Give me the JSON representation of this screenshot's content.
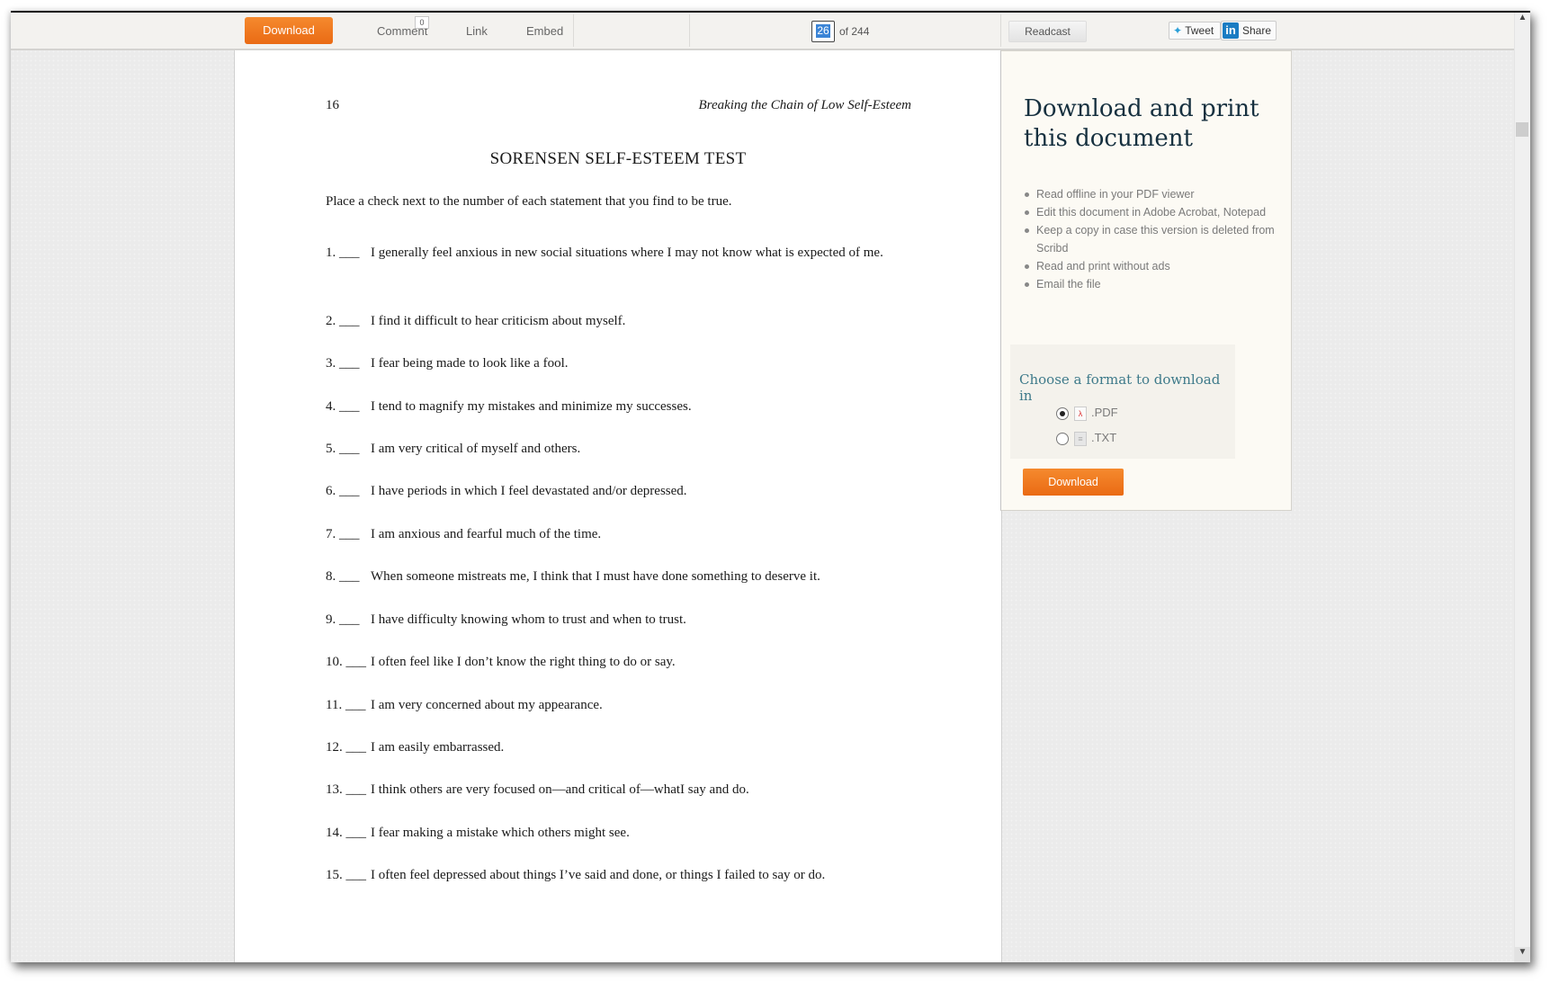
{
  "toolbar": {
    "download_label": "Download",
    "comment_label": "Comment",
    "comment_count": "0",
    "link_label": "Link",
    "embed_label": "Embed",
    "page_current": "26",
    "page_of": "of 244",
    "readcast_label": "Readcast",
    "tweet_label": "Tweet",
    "share_label": "Share",
    "accent_color": "#ef7a21"
  },
  "document": {
    "page_number": "16",
    "running_head": "Breaking the Chain of Low Self-Esteem",
    "title": "SORENSEN SELF-ESTEEM TEST",
    "intro": "Place a check next to the number of each statement that you find to be true.",
    "items": [
      {
        "num": "1. ___",
        "text": "I generally feel anxious in new social situations where I may not know what is expected of me."
      },
      {
        "num": "2. ___",
        "text": "I find it difficult to hear criticism about myself."
      },
      {
        "num": "3. ___",
        "text": "I fear being made to look like a fool."
      },
      {
        "num": "4. ___",
        "text": "I tend to magnify my mistakes and minimize my successes."
      },
      {
        "num": "5. ___",
        "text": "I am very critical of myself and others."
      },
      {
        "num": "6. ___",
        "text": "I have periods in which I feel devastated and/or depressed."
      },
      {
        "num": "7. ___",
        "text": "I am anxious and fearful much of the time."
      },
      {
        "num": "8. ___",
        "text": "When someone mistreats me, I think that I must have done something to deserve it."
      },
      {
        "num": "9. ___",
        "text": "I have difficulty knowing whom to trust and when to trust."
      },
      {
        "num": "10. ___",
        "text": "I often feel like I don’t know the right thing to do or say."
      },
      {
        "num": "11. ___",
        "text": "I am very concerned about my appearance."
      },
      {
        "num": "12. ___",
        "text": "I am easily embarrassed."
      },
      {
        "num": "13. ___",
        "text": "I think others are very focused on—and critical of—whatI say and do."
      },
      {
        "num": "14. ___",
        "text": "I fear making a mistake which others might see."
      },
      {
        "num": "15. ___",
        "text": "I often feel depressed about things I’ve said and done, or things I failed to say or do."
      }
    ]
  },
  "side_panel": {
    "title": "Download and print this document",
    "benefits": [
      "Read offline in your PDF viewer",
      "Edit this document in Adobe Acrobat, Notepad",
      "Keep a copy in case this version is deleted from Scribd",
      "Read and print without ads",
      "Email the file"
    ],
    "format_title": "Choose a format to download in",
    "formats": [
      {
        "label": ".PDF",
        "selected": true,
        "icon": "pdf-file-icon"
      },
      {
        "label": ".TXT",
        "selected": false,
        "icon": "txt-file-icon"
      }
    ],
    "download_label": "Download"
  }
}
